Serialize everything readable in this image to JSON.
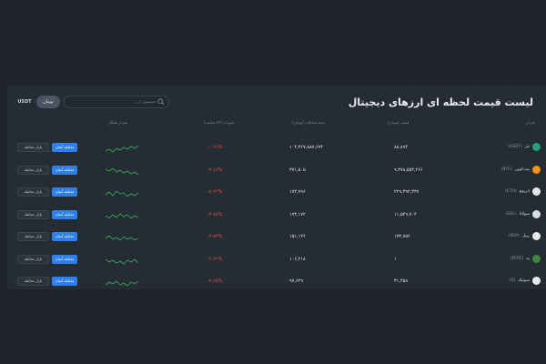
{
  "title": "لیست قیمت لحظه ای ارزهای دیجیتال",
  "search": {
    "placeholder": "جستجوی ارز..."
  },
  "currency_toggle": {
    "toman": "تومان",
    "usdt": "USDT",
    "selected": "toman"
  },
  "columns": {
    "name": "نام ارز",
    "price": "قیمت (تومان)",
    "volume": "حجم معاملات (تومان)",
    "change": "تغییرات (۲۴ ساعت)",
    "chart": "نمودار هفتگی"
  },
  "rows": [
    {
      "name": "تتر",
      "symbol": "(USDT)",
      "icon": "usdt-icon",
      "color": "#26a17b",
      "price": "۸۸,۸۹۴",
      "volume": "۱۰۴,۳۶۷,۸۸۷,۶۷۴",
      "change": "-۰.۶۱%",
      "trade": "معامله آسان",
      "market": "بازار معامله"
    },
    {
      "name": "بیت‌کوین",
      "symbol": "(BTC)",
      "icon": "btc-icon",
      "color": "#f7931a",
      "price": "۹,۳۷۸,۵۵۳,۲۶۶",
      "volume": "۳۷۱,۵۰۵",
      "change": "-۳.۱۸%",
      "trade": "معامله آسان",
      "market": "بازار معامله"
    },
    {
      "name": "اتریوم",
      "symbol": "(ETH)",
      "icon": "eth-icon",
      "color": "#e6e9ed",
      "price": "۲۲۹,۳۹۲,۳۳۷",
      "volume": "۱۷۳,۷۹۶",
      "change": "-۵.۲۲%",
      "trade": "معامله آسان",
      "market": "بازار معامله"
    },
    {
      "name": "سولانا",
      "symbol": "(SOL)",
      "icon": "sol-icon",
      "color": "#d9dde3",
      "price": "۱۱,۵۴۹,۷۰۴",
      "volume": "۱۷۳,۱۷۲",
      "change": "-۳.۷۵%",
      "trade": "معامله آسان",
      "market": "بازار معامله"
    },
    {
      "name": "ریپل",
      "symbol": "(XRP)",
      "icon": "xrp-icon",
      "color": "#e6e9ed",
      "price": "۱۷۳,۷۵۶",
      "volume": "۱۵۱,۱۲۶",
      "change": "-۳.۷۳%",
      "trade": "معامله آسان",
      "market": "بازار معامله"
    },
    {
      "name": "په",
      "symbol": "(PEPE)",
      "icon": "pepe-icon",
      "color": "#3b8b3a",
      "price": "۱",
      "volume": "۱۰۶,۲۱۸",
      "change": "-۶.۶۲%",
      "trade": "معامله آسان",
      "market": "بازار معامله"
    },
    {
      "name": "سونیک",
      "symbol": "(S)",
      "icon": "sonic-icon",
      "color": "#e6e9ed",
      "price": "۳۱,۴۵۸",
      "volume": "۹۷,۶۲۹",
      "change": "-۹.۲۵%",
      "trade": "معامله آسان",
      "market": "بازار معامله"
    }
  ]
}
